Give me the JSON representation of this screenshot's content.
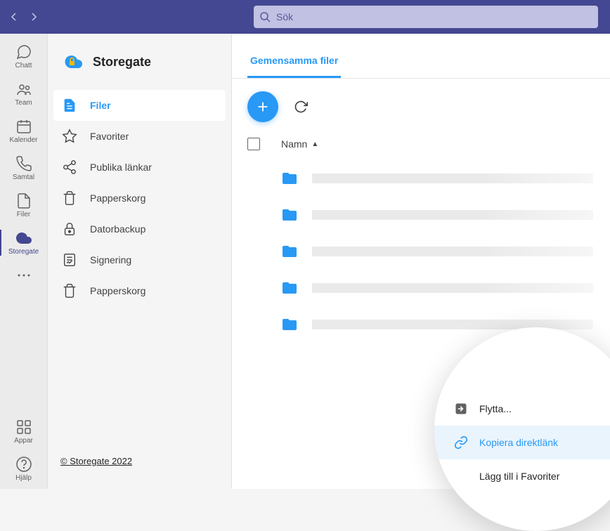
{
  "search": {
    "placeholder": "Sök"
  },
  "rail": {
    "items": [
      {
        "label": "Chatt"
      },
      {
        "label": "Team"
      },
      {
        "label": "Kalender"
      },
      {
        "label": "Samtal"
      },
      {
        "label": "Filer"
      },
      {
        "label": "Storegate"
      }
    ],
    "apps": "Appar",
    "help": "Hjälp"
  },
  "app": {
    "title": "Storegate",
    "footer": "© Storegate 2022"
  },
  "side": {
    "items": [
      {
        "label": "Filer"
      },
      {
        "label": "Favoriter"
      },
      {
        "label": "Publika länkar"
      },
      {
        "label": "Papperskorg"
      },
      {
        "label": "Datorbackup"
      },
      {
        "label": "Signering"
      },
      {
        "label": "Papperskorg"
      }
    ]
  },
  "tabs": {
    "shared": "Gemensamma filer"
  },
  "table": {
    "name": "Namn"
  },
  "context": {
    "move": "Flytta...",
    "copyLink": "Kopiera direktlänk",
    "addFav": "Lägg till i Favoriter"
  }
}
